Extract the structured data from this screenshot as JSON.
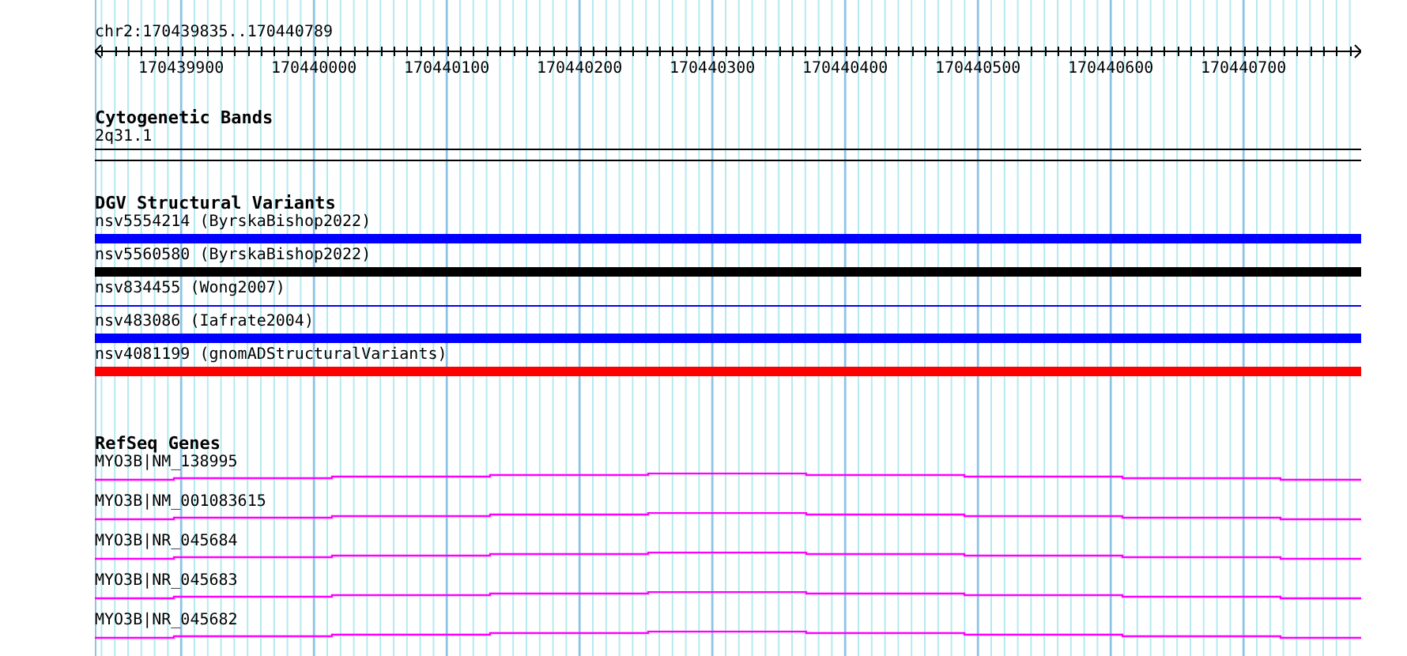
{
  "location": "chr2:170439835..170440789",
  "ruler": {
    "labels": [
      "170439900",
      "170440000",
      "170440100",
      "170440200",
      "170440300",
      "170440400",
      "170440500",
      "170440600",
      "170440700"
    ]
  },
  "cytogenetic_bands": {
    "title": "Cytogenetic Bands",
    "band": "2q31.1"
  },
  "dgv_structural_variants": {
    "title": "DGV Structural Variants",
    "items": [
      {
        "label": "nsv5554214 (ByrskaBishop2022)",
        "kind": "thick",
        "color": "#0000ff"
      },
      {
        "label": "nsv5560580 (ByrskaBishop2022)",
        "kind": "thick",
        "color": "#000000"
      },
      {
        "label": "nsv834455 (Wong2007)",
        "kind": "thin",
        "color": "#0000ff"
      },
      {
        "label": "nsv483086 (Iafrate2004)",
        "kind": "thick",
        "color": "#0000ff"
      },
      {
        "label": "nsv4081199 (gnomADStructuralVariants)",
        "kind": "thick",
        "color": "#ff0000"
      }
    ]
  },
  "refseq_genes": {
    "title": "RefSeq Genes",
    "items": [
      {
        "label": "MYO3B|NM_138995"
      },
      {
        "label": "MYO3B|NM_001083615"
      },
      {
        "label": "MYO3B|NR_045684"
      },
      {
        "label": "MYO3B|NR_045683"
      },
      {
        "label": "MYO3B|NR_045682"
      }
    ]
  }
}
